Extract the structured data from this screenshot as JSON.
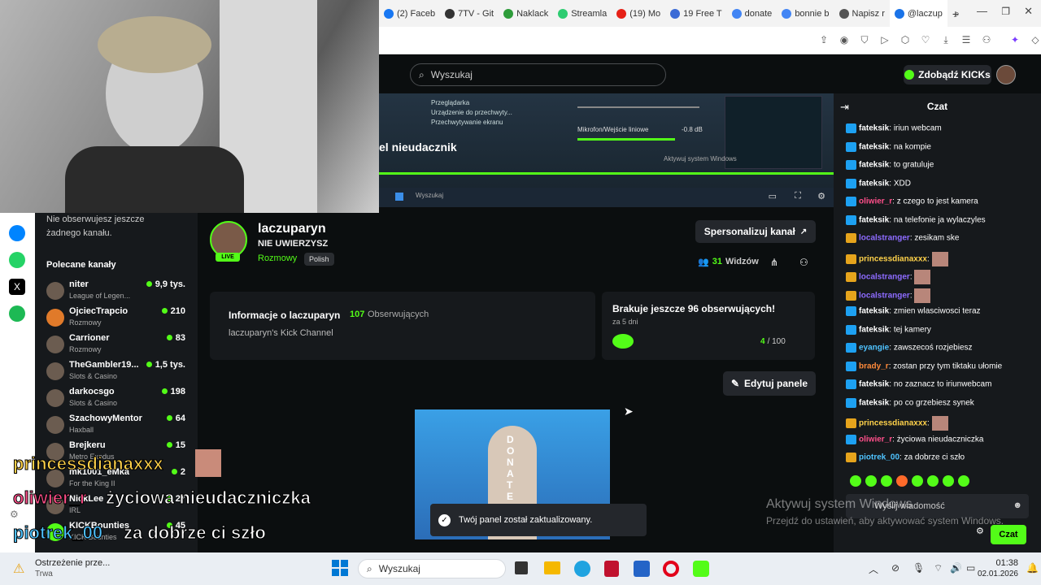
{
  "browser": {
    "tabs": [
      {
        "label": "(2) Faceb",
        "color": "#1877f2"
      },
      {
        "label": "7TV - Git",
        "color": "#333333"
      },
      {
        "label": "Naklack",
        "color": "#2e9c3a"
      },
      {
        "label": "Streamla",
        "color": "#2ecc71"
      },
      {
        "label": "(19) Mo",
        "color": "#e62117"
      },
      {
        "label": "19 Free T",
        "color": "#3b6bd6"
      },
      {
        "label": "donate",
        "color": "#4285f4"
      },
      {
        "label": "bonnie b",
        "color": "#4285f4"
      },
      {
        "label": "Napisz r",
        "color": "#555555"
      },
      {
        "label": "@laczup",
        "color": "#1a73e8"
      }
    ],
    "new_tab": "+"
  },
  "kick": {
    "search_placeholder": "Wyszukaj",
    "kicks_button": "Zdobądź KICKs",
    "video_text": "el nieudacznik",
    "video_mic_label": "Mikrofon/Wejście liniowe",
    "video_db": "-0.8 dB",
    "video_items": [
      "Przeglądarka",
      "Urządzenie do przechwyty...",
      "Przechwytywanie ekranu"
    ],
    "activate": "Aktywuj system Windows",
    "video_taskbar_search": "Wyszukaj"
  },
  "sidebar": {
    "not_following": "Nie obserwujesz jeszcze żadnego kanału.",
    "recommended": "Polecane kanały",
    "channels": [
      {
        "name": "niter",
        "category": "League of Legen...",
        "viewers": "9,9 tys."
      },
      {
        "name": "OjciecTrapcio",
        "category": "Rozmowy",
        "viewers": "210"
      },
      {
        "name": "Carrioner",
        "category": "Rozmowy",
        "viewers": "83"
      },
      {
        "name": "TheGambler19...",
        "category": "Slots & Casino",
        "viewers": "1,5 tys."
      },
      {
        "name": "darkocsgo",
        "category": "Slots & Casino",
        "viewers": "198"
      },
      {
        "name": "SzachowyMentor1...",
        "category": "Haxball",
        "viewers": "64"
      },
      {
        "name": "Brejkeru",
        "category": "Metro Exodus",
        "viewers": "15"
      },
      {
        "name": "mk1001_eMka",
        "category": "For the King II",
        "viewers": "2"
      },
      {
        "name": "NickLee",
        "category": "IRL",
        "viewers": "27"
      },
      {
        "name": "KICKBounties",
        "category": "KICK Bounties",
        "viewers": "45"
      }
    ]
  },
  "channel": {
    "name": "laczuparyn",
    "title": "NIE UWIERZYSZ",
    "category": "Rozmowy",
    "language": "Polish",
    "live": "LIVE",
    "customize": "Spersonalizuj kanał",
    "viewers": "31",
    "viewers_label": "Widzów",
    "about_title": "Informacje o laczuparyn",
    "followers": "107",
    "followers_label": "Obserwujących",
    "about_desc": "laczuparyn's Kick Channel",
    "goal_title": "Brakuje jeszcze 96 obserwujących!",
    "goal_sub": "za 5 dni",
    "goal_current": "4",
    "goal_total": "/ 100",
    "edit_panels": "Edytuj panele",
    "panel_image_text": "DONATE",
    "toast": "Twój panel został zaktualizowany."
  },
  "chat": {
    "title": "Czat",
    "messages": [
      {
        "user": "fateksik",
        "color": "#ffffff",
        "badge": "#1da1f2",
        "text": "iriun webcam"
      },
      {
        "user": "fateksik",
        "color": "#ffffff",
        "badge": "#1da1f2",
        "text": "na kompie"
      },
      {
        "user": "fateksik",
        "color": "#ffffff",
        "badge": "#1da1f2",
        "text": "to gratuluje"
      },
      {
        "user": "fateksik",
        "color": "#ffffff",
        "badge": "#1da1f2",
        "text": "XDD"
      },
      {
        "user": "oliwier_r",
        "color": "#ff4f8a",
        "badge": "#1da1f2",
        "text": "z czego to jest kamera"
      },
      {
        "user": "fateksik",
        "color": "#ffffff",
        "badge": "#1da1f2",
        "text": "na telefonie ja wylaczyles"
      },
      {
        "user": "localstranger",
        "color": "#8d6bff",
        "badge": "#e6a41c",
        "text": "zesikam ske"
      },
      {
        "user": "princessdianaxxx",
        "color": "#ffd24a",
        "badge": "#e6a41c",
        "text": ""
      },
      {
        "user": "localstranger",
        "color": "#8d6bff",
        "badge": "#e6a41c",
        "text": ""
      },
      {
        "user": "localstranger",
        "color": "#8d6bff",
        "badge": "#e6a41c",
        "text": ""
      },
      {
        "user": "fateksik",
        "color": "#ffffff",
        "badge": "#1da1f2",
        "text": "zmien wlasciwosci teraz"
      },
      {
        "user": "fateksik",
        "color": "#ffffff",
        "badge": "#1da1f2",
        "text": "tej kamery"
      },
      {
        "user": "eyangie",
        "color": "#4fc3ff",
        "badge": "#1da1f2",
        "text": "zawszecoś rozjebiesz"
      },
      {
        "user": "brady_r",
        "color": "#ff8a3a",
        "badge": "#1da1f2",
        "text": "zostan przy tym tiktaku ułomie"
      },
      {
        "user": "fateksik",
        "color": "#ffffff",
        "badge": "#1da1f2",
        "text": "no zaznacz to iriunwebcam"
      },
      {
        "user": "fateksik",
        "color": "#ffffff",
        "badge": "#1da1f2",
        "text": "po co grzebiesz synek"
      },
      {
        "user": "princessdianaxxx",
        "color": "#ffd24a",
        "badge": "#e6a41c",
        "text": ""
      },
      {
        "user": "oliwier_r",
        "color": "#ff4f8a",
        "badge": "#1da1f2",
        "text": "życiowa nieudaczniczka"
      },
      {
        "user": "piotrek_00",
        "color": "#4fc3ff",
        "badge": "#e6a41c",
        "text": "za dobrze ci szło"
      }
    ],
    "input_placeholder": "Wyślij wiadomość",
    "send": "Czat",
    "activate_title": "Aktywuj system Windows",
    "activate_sub": "Przejdź do ustawień, aby aktywować system Windows."
  },
  "overlay": {
    "lines": [
      {
        "user": "princessdianaxxx",
        "text": "",
        "color": "#ffd24a"
      },
      {
        "user": "oliwier_r",
        "text": "życiowa nieudaczniczka",
        "color": "#ff4f8a"
      },
      {
        "user": "piotrek_00",
        "text": "za dobrze ci szło",
        "color": "#4fc3ff"
      }
    ]
  },
  "taskbar": {
    "notification_title": "Ostrzeżenie prze...",
    "notification_sub": "Trwa",
    "search": "Wyszukaj",
    "time": "01:38",
    "date": "02.01.2026"
  }
}
